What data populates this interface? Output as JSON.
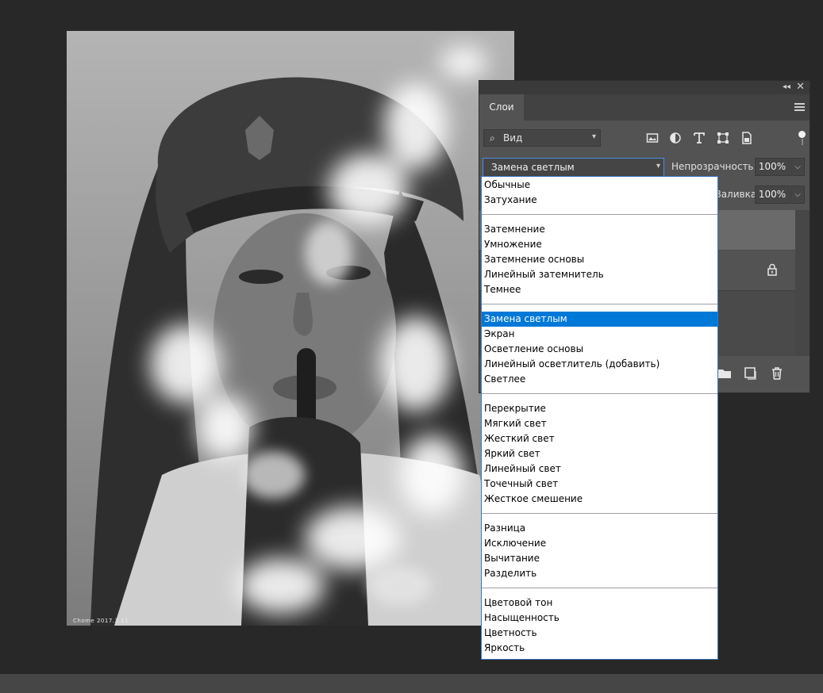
{
  "photo": {
    "signature": "Chome  2017.3.11"
  },
  "layers_panel": {
    "tab_label": "Слои",
    "filter": {
      "label": "Вид",
      "icons": [
        "image-filter-icon",
        "adjustment-filter-icon",
        "type-filter-icon",
        "shape-filter-icon",
        "smart-object-filter-icon"
      ]
    },
    "blend_mode": "Замена светлым",
    "opacity_label": "Непрозрачность:",
    "opacity_value": "100%",
    "fill_label": "Заливка:",
    "fill_value": "100%"
  },
  "blend_dropdown": {
    "groups": [
      [
        "Обычные",
        "Затухание"
      ],
      [
        "Затемнение",
        "Умножение",
        "Затемнение основы",
        "Линейный затемнитель",
        "Темнее"
      ],
      [
        "Замена светлым",
        "Экран",
        "Осветление основы",
        "Линейный осветлитель (добавить)",
        "Светлее"
      ],
      [
        "Перекрытие",
        "Мягкий свет",
        "Жесткий свет",
        "Яркий свет",
        "Линейный свет",
        "Точечный свет",
        "Жесткое смешение"
      ],
      [
        "Разница",
        "Исключение",
        "Вычитание",
        "Разделить"
      ],
      [
        "Цветовой тон",
        "Насыщенность",
        "Цветность",
        "Яркость"
      ]
    ],
    "selected": "Замена светлым"
  },
  "colors": {
    "workspace": "#282828",
    "panel": "#535353",
    "selection": "#0078d7",
    "dropdown_border": "#3a78c5"
  }
}
